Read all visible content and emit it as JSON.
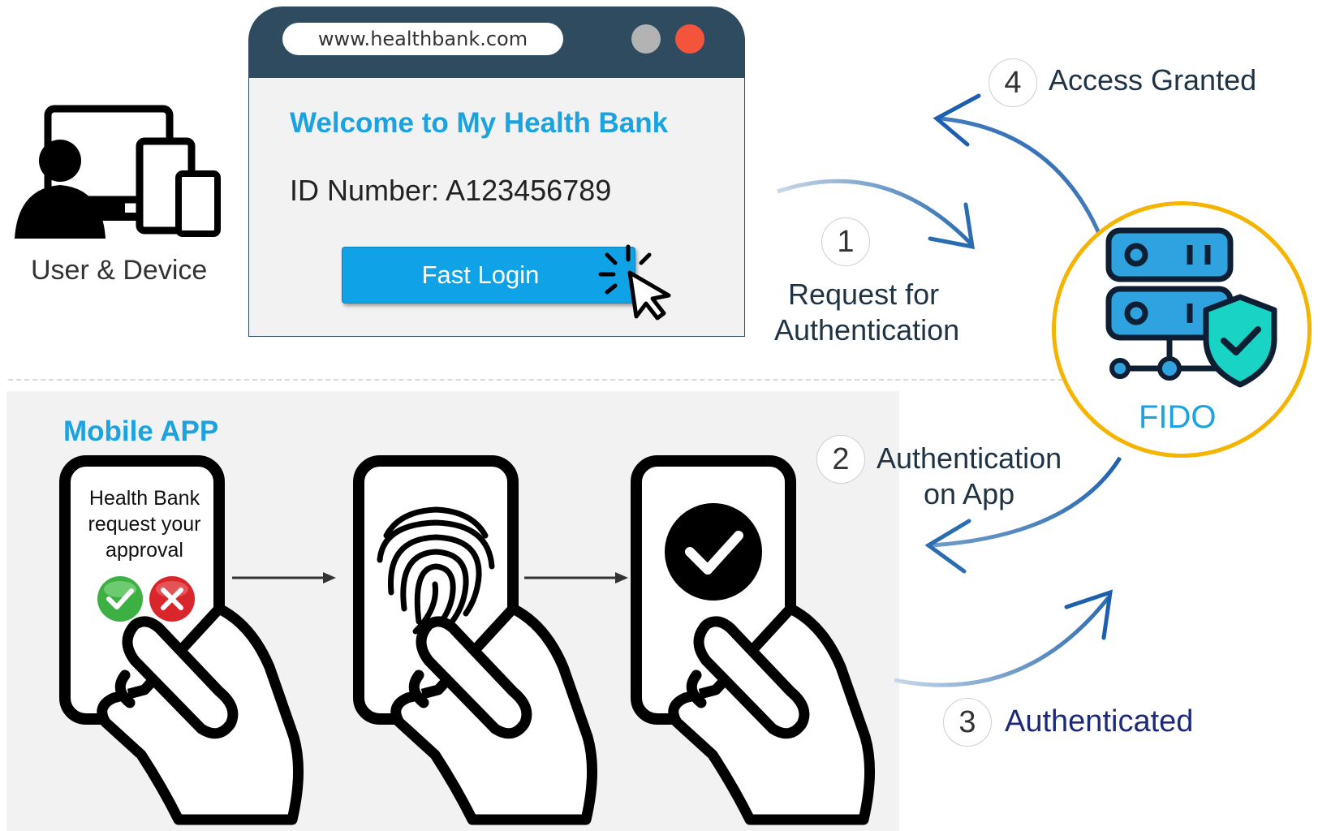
{
  "browser": {
    "url": "www.healthbank.com",
    "welcome": "Welcome to My Health Bank",
    "id_number": "ID Number: A123456789",
    "login_button": "Fast Login"
  },
  "user": {
    "label": "User & Device"
  },
  "steps": [
    {
      "number": "1",
      "label_line1": "Request for",
      "label_line2": "Authentication"
    },
    {
      "number": "2",
      "label_line1": "Authentication",
      "label_line2": "on App"
    },
    {
      "number": "3",
      "label": "Authenticated"
    },
    {
      "number": "4",
      "label": "Access Granted"
    }
  ],
  "fido": {
    "label": "FIDO"
  },
  "mobile": {
    "title": "Mobile  APP",
    "request_line1": "Health Bank",
    "request_line2": "request your",
    "request_line3": "approval"
  },
  "colors": {
    "accent": "#1aa3e0",
    "browser_bar": "#2f4b5f",
    "arrow": "#2b6cb0",
    "fido_ring": "#f4b400",
    "shield": "#19d3c5",
    "approve": "#3cb043",
    "reject": "#d9262b",
    "step3_text": "#1b2a7a"
  },
  "icons": [
    "user-device-icon",
    "cursor-click-icon",
    "server-icon",
    "shield-check-icon",
    "fingerprint-icon",
    "check-circle-icon",
    "hand-phone-icon",
    "approve-icon",
    "reject-icon"
  ]
}
